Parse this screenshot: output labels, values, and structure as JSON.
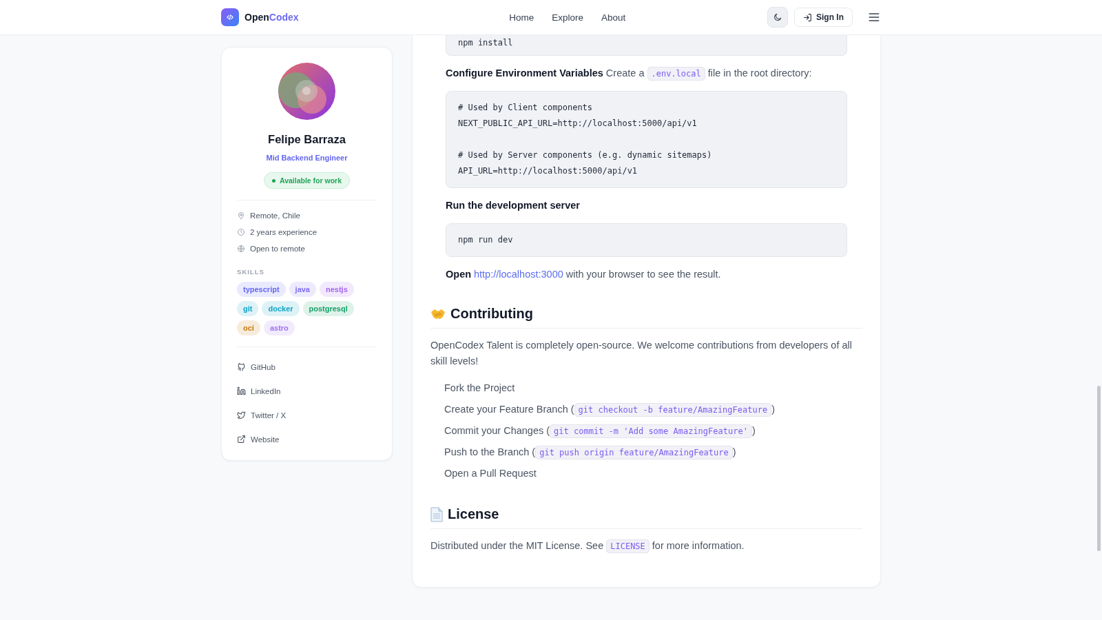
{
  "header": {
    "logo": {
      "prefix": "Open",
      "accent": "Codex"
    },
    "nav": [
      {
        "label": "Home"
      },
      {
        "label": "Explore"
      },
      {
        "label": "About"
      }
    ],
    "sign_in": "Sign In"
  },
  "profile": {
    "name": "Felipe Barraza",
    "title": "Mid Backend Engineer",
    "status": {
      "label": "Available for work",
      "available": true
    },
    "details": [
      {
        "kind": "location",
        "text": "Remote, Chile"
      },
      {
        "kind": "experience",
        "text": "2 years experience"
      },
      {
        "kind": "remote",
        "text": "Open to remote"
      }
    ],
    "skills_heading": "SKILLS",
    "skills": [
      {
        "label": "typescript",
        "color": "#6366f1"
      },
      {
        "label": "java",
        "color": "#7c6cf0"
      },
      {
        "label": "nestjs",
        "color": "#a265f0"
      },
      {
        "label": "git",
        "color": "#0ea5c6"
      },
      {
        "label": "docker",
        "color": "#0ea5c6"
      },
      {
        "label": "postgresql",
        "color": "#16a06a"
      },
      {
        "label": "oci",
        "color": "#c77808"
      },
      {
        "label": "astro",
        "color": "#a070ee"
      }
    ],
    "links": [
      {
        "kind": "github",
        "label": "GitHub"
      },
      {
        "kind": "linkedin",
        "label": "LinkedIn"
      },
      {
        "kind": "twitter",
        "label": "Twitter / X"
      },
      {
        "kind": "website",
        "label": "Website"
      }
    ]
  },
  "content": {
    "blocks": [
      {
        "kind": "code",
        "groups": [
          [
            "npm install"
          ]
        ]
      },
      {
        "kind": "paragraph",
        "segments": [
          {
            "kind": "strong",
            "text": "Configure Environment Variables"
          },
          {
            "kind": "text",
            "text": " Create a "
          },
          {
            "kind": "code",
            "text": ".env.local"
          },
          {
            "kind": "text",
            "text": " file in the root directory:"
          }
        ]
      },
      {
        "kind": "code",
        "groups": [
          [
            "# Used by Client components",
            "NEXT_PUBLIC_API_URL=http://localhost:5000/api/v1"
          ],
          [
            "# Used by Server components (e.g. dynamic sitemaps)",
            "API_URL=http://localhost:5000/api/v1"
          ]
        ]
      },
      {
        "kind": "paragraph",
        "segments": [
          {
            "kind": "strong",
            "text": "Run the development server"
          }
        ]
      },
      {
        "kind": "code",
        "groups": [
          [
            "npm run dev"
          ]
        ]
      },
      {
        "kind": "paragraph",
        "segments": [
          {
            "kind": "strong",
            "text": "Open"
          },
          {
            "kind": "link",
            "text": "http://localhost:3000"
          },
          {
            "kind": "text",
            "text": " with your browser to see the result."
          }
        ]
      },
      {
        "kind": "heading",
        "text": "Contributing"
      },
      {
        "kind": "body",
        "segments": [
          {
            "kind": "text",
            "text": "OpenCodex Talent is completely open-source. We welcome contributions from developers of all skill levels!"
          }
        ]
      },
      {
        "kind": "list",
        "items": [
          [
            {
              "kind": "text",
              "text": "Fork the Project"
            }
          ],
          [
            {
              "kind": "text",
              "text": "Create your Feature Branch ("
            },
            {
              "kind": "code",
              "text": "git checkout -b feature/AmazingFeature"
            },
            {
              "kind": "text",
              "text": ")"
            }
          ],
          [
            {
              "kind": "text",
              "text": "Commit your Changes ("
            },
            {
              "kind": "code",
              "text": "git commit -m 'Add some AmazingFeature'"
            },
            {
              "kind": "text",
              "text": ")"
            }
          ],
          [
            {
              "kind": "text",
              "text": "Push to the Branch ("
            },
            {
              "kind": "code",
              "text": "git push origin feature/AmazingFeature"
            },
            {
              "kind": "text",
              "text": ")"
            }
          ],
          [
            {
              "kind": "text",
              "text": "Open a Pull Request"
            }
          ]
        ]
      },
      {
        "kind": "heading",
        "text": "License"
      },
      {
        "kind": "body",
        "segments": [
          {
            "kind": "text",
            "text": "Distributed under the MIT License. See "
          },
          {
            "kind": "code",
            "text": "LICENSE"
          },
          {
            "kind": "text",
            "text": " for more information."
          }
        ]
      }
    ]
  }
}
